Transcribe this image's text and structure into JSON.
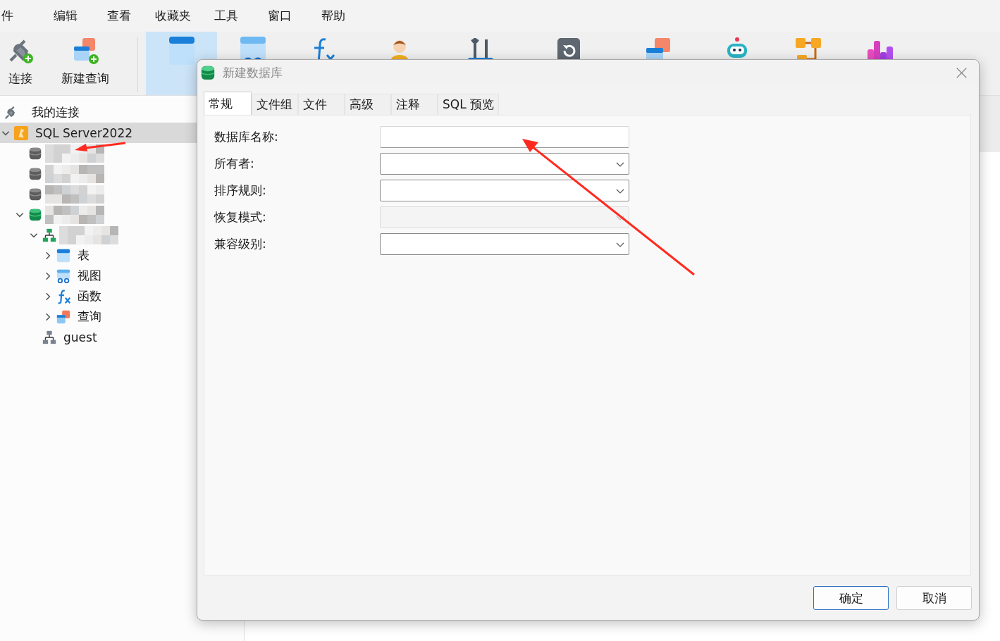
{
  "menu": [
    "件",
    "编辑",
    "查看",
    "收藏夹",
    "工具",
    "窗口",
    "帮助"
  ],
  "toolbar": [
    {
      "kind": "connect",
      "label": "连接",
      "selected": false
    },
    {
      "kind": "new-query",
      "label": "新建查询",
      "selected": false
    },
    {
      "kind": "separator"
    },
    {
      "kind": "table",
      "selected": true
    },
    {
      "kind": "view",
      "selected": false
    },
    {
      "kind": "function",
      "selected": false
    },
    {
      "kind": "user",
      "selected": false
    },
    {
      "kind": "tools",
      "selected": false
    },
    {
      "kind": "backup",
      "selected": false
    },
    {
      "kind": "query",
      "selected": false
    },
    {
      "kind": "robot",
      "selected": false
    },
    {
      "kind": "model",
      "selected": false
    },
    {
      "kind": "chart",
      "selected": false
    }
  ],
  "sidebar": {
    "header": "我的连接",
    "tree": [
      {
        "kind": "server",
        "label": "SQL Server2022",
        "expanded": true,
        "selected": true,
        "children": [
          {
            "kind": "db",
            "redacted": true
          },
          {
            "kind": "db",
            "redacted": true
          },
          {
            "kind": "db",
            "redacted": true
          },
          {
            "kind": "db-open",
            "redacted": true,
            "expanded": true,
            "children": [
              {
                "kind": "schema-open",
                "redacted": true,
                "expanded": true,
                "children": [
                  {
                    "kind": "table",
                    "label": "表",
                    "expanded": false
                  },
                  {
                    "kind": "view",
                    "label": "视图",
                    "expanded": false
                  },
                  {
                    "kind": "function",
                    "label": "函数",
                    "expanded": false
                  },
                  {
                    "kind": "query",
                    "label": "查询",
                    "expanded": false
                  }
                ]
              },
              {
                "kind": "schema",
                "label": "guest"
              }
            ]
          }
        ]
      }
    ]
  },
  "dialog": {
    "title": "新建数据库",
    "tabs": [
      {
        "label": "常规",
        "selected": true
      },
      {
        "label": "文件组",
        "selected": false
      },
      {
        "label": "文件",
        "selected": false
      },
      {
        "label": "高级",
        "selected": false
      },
      {
        "label": "注释",
        "selected": false
      },
      {
        "label": "SQL 预览",
        "selected": false
      }
    ],
    "fields": [
      {
        "label": "数据库名称:",
        "kind": "text",
        "disabled": false
      },
      {
        "label": "所有者:",
        "kind": "select",
        "disabled": false
      },
      {
        "label": "排序规则:",
        "kind": "select",
        "disabled": false
      },
      {
        "label": "恢复模式:",
        "kind": "select",
        "disabled": true
      },
      {
        "label": "兼容级别:",
        "kind": "select",
        "disabled": false
      }
    ],
    "buttons": [
      {
        "label": "确定",
        "default": true
      },
      {
        "label": "取消",
        "default": false
      }
    ]
  },
  "annotations": [
    {
      "kind": "arrow",
      "color": "#ff2a1f"
    },
    {
      "kind": "arrow",
      "color": "#ff2a1f"
    }
  ]
}
